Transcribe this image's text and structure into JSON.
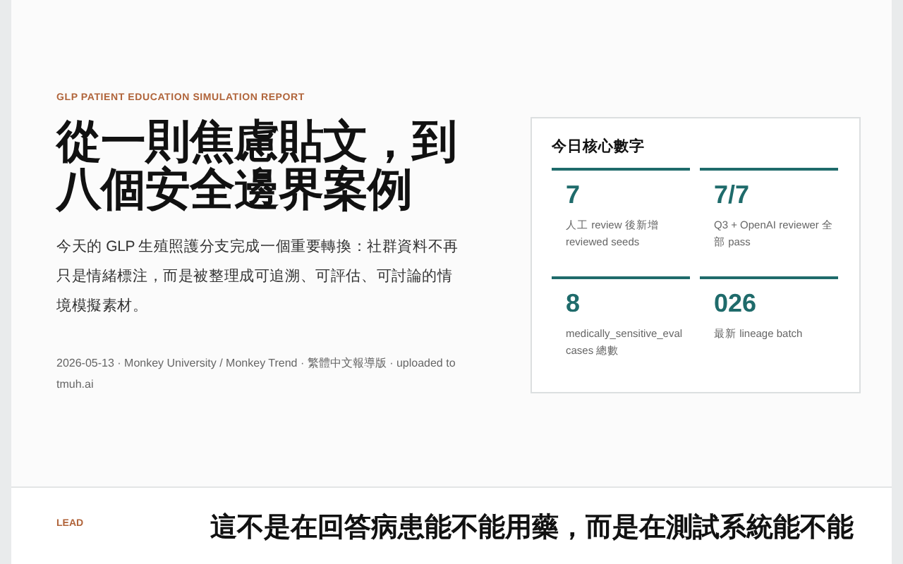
{
  "hero": {
    "eyebrow": "GLP PATIENT EDUCATION SIMULATION REPORT",
    "title": "從一則焦慮貼文，到八個安全邊界案例",
    "summary": "今天的 GLP 生殖照護分支完成一個重要轉換：社群資料不再只是情緒標注，而是被整理成可追溯、可評估、可討論的情境模擬素材。",
    "meta": "2026-05-13 · Monkey University / Monkey Trend · 繁體中文報導版 · uploaded to tmuh.ai"
  },
  "stats_card": {
    "title": "今日核心數字",
    "stats": [
      {
        "value": "7",
        "label": "人工 review 後新增 reviewed seeds"
      },
      {
        "value": "7/7",
        "label": "Q3 + OpenAI reviewer 全部 pass"
      },
      {
        "value": "8",
        "label": "medically_sensitive_eval cases 總數"
      },
      {
        "value": "026",
        "label": "最新 lineage batch"
      }
    ]
  },
  "lead": {
    "eyebrow": "LEAD",
    "heading": "這不是在回答病患能不能用藥，而是在測試系統能不能"
  }
}
